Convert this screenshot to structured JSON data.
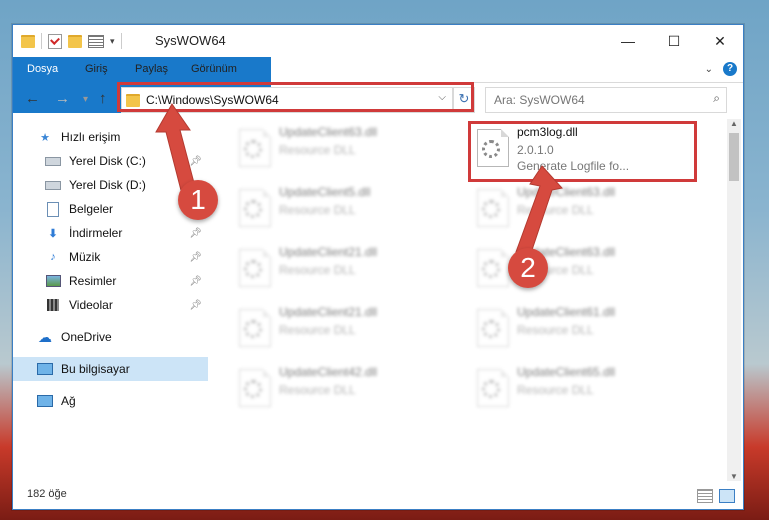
{
  "window": {
    "title": "SysWOW64",
    "controls": {
      "minimize": "—",
      "maximize": "☐",
      "close": "✕"
    }
  },
  "ribbon": {
    "tabs": [
      "Dosya",
      "Giriş",
      "Paylaş",
      "Görünüm"
    ],
    "expand": "⌄",
    "help": "?"
  },
  "navigation": {
    "back": "←",
    "forward": "→",
    "up": "↑",
    "address": "C:\\Windows\\SysWOW64",
    "refresh": "↻",
    "search_placeholder": "Ara: SysWOW64"
  },
  "sidebar": {
    "items": [
      {
        "label": "Hızlı erişim",
        "icon": "star-icon"
      },
      {
        "label": "Yerel Disk (C:)",
        "icon": "drive-icon",
        "pinned": true
      },
      {
        "label": "Yerel Disk (D:)",
        "icon": "drive-icon"
      },
      {
        "label": "Belgeler",
        "icon": "documents-icon"
      },
      {
        "label": "İndirmeler",
        "icon": "download-icon",
        "pinned": true
      },
      {
        "label": "Müzik",
        "icon": "music-icon",
        "pinned": true
      },
      {
        "label": "Resimler",
        "icon": "pictures-icon",
        "pinned": true
      },
      {
        "label": "Videolar",
        "icon": "videos-icon",
        "pinned": true
      },
      {
        "label": "OneDrive",
        "icon": "cloud-icon"
      },
      {
        "label": "Bu bilgisayar",
        "icon": "computer-icon",
        "selected": true
      },
      {
        "label": "Ağ",
        "icon": "network-icon"
      }
    ]
  },
  "files": {
    "left_column": [
      {
        "name": "UpdateClient63.dll",
        "type": "Resource DLL"
      },
      {
        "name": "UpdateClient5.dll",
        "type": "Resource DLL"
      },
      {
        "name": "UpdateClient21.dll",
        "type": "Resource DLL"
      },
      {
        "name": "UpdateClient21.dll",
        "type": "Resource DLL"
      },
      {
        "name": "UpdateClient42.dll",
        "type": "Resource DLL"
      }
    ],
    "right_column": [
      {
        "name": "pcm3log.dll",
        "version": "2.0.1.0",
        "description": "Generate Logfile fo..."
      },
      {
        "name": "UpdateClient63.dll",
        "type": "Resource DLL"
      },
      {
        "name": "UpdateClient63.dll",
        "type": "Resource DLL"
      },
      {
        "name": "UpdateClient61.dll",
        "type": "Resource DLL"
      },
      {
        "name": "UpdateClient65.dll",
        "type": "Resource DLL"
      }
    ]
  },
  "status": {
    "count": "182 öğe"
  },
  "annotations": {
    "step1": "1",
    "step2": "2",
    "accent": "#d64a3f"
  }
}
